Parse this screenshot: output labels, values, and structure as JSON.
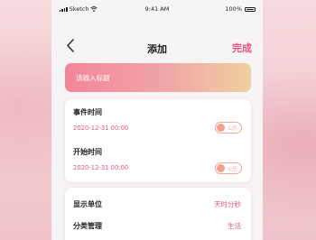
{
  "status_bar": {
    "carrier": "Sketch",
    "time": "9:41 AM",
    "battery": "100%"
  },
  "nav": {
    "title": "添加",
    "done_label": "完成"
  },
  "title_input": {
    "placeholder": "请输入标题"
  },
  "event_time": {
    "label": "事件时间",
    "value": "2020-12-31  00:00",
    "toggle_label": "公历",
    "toggle_on": false
  },
  "start_time": {
    "label": "开始时间",
    "value": "2020-12-31  00:00",
    "toggle_label": "公历",
    "toggle_on": false
  },
  "settings": {
    "display_unit_label": "显示单位",
    "display_unit_value": "天时分秒",
    "category_label": "分类管理",
    "category_value": "生活"
  },
  "colors": {
    "accent": "#e6557d",
    "gradient_start": "#f3869a",
    "gradient_end": "#efd0a0",
    "toggle": "#f3a08f"
  },
  "icons": {
    "back": "chevron-left-icon",
    "signal": "signal-icon",
    "wifi": "wifi-icon",
    "battery": "battery-icon"
  }
}
